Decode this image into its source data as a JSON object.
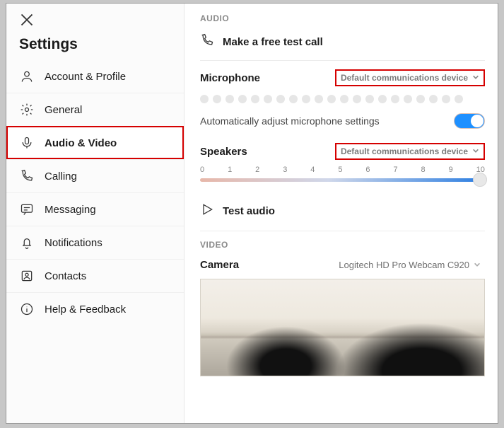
{
  "sidebar": {
    "title": "Settings",
    "items": [
      {
        "label": "Account & Profile"
      },
      {
        "label": "General"
      },
      {
        "label": "Audio & Video"
      },
      {
        "label": "Calling"
      },
      {
        "label": "Messaging"
      },
      {
        "label": "Notifications"
      },
      {
        "label": "Contacts"
      },
      {
        "label": "Help & Feedback"
      }
    ],
    "active_index": 2
  },
  "audio": {
    "section_label": "AUDIO",
    "test_call": "Make a free test call",
    "microphone_label": "Microphone",
    "microphone_device": "Default communications device",
    "auto_adjust_label": "Automatically adjust microphone settings",
    "auto_adjust_on": true,
    "speakers_label": "Speakers",
    "speakers_device": "Default communications device",
    "speakers_scale": [
      "0",
      "1",
      "2",
      "3",
      "4",
      "5",
      "6",
      "7",
      "8",
      "9",
      "10"
    ],
    "speakers_value": 10,
    "test_audio": "Test audio"
  },
  "video": {
    "section_label": "VIDEO",
    "camera_label": "Camera",
    "camera_device": "Logitech HD Pro Webcam C920"
  }
}
